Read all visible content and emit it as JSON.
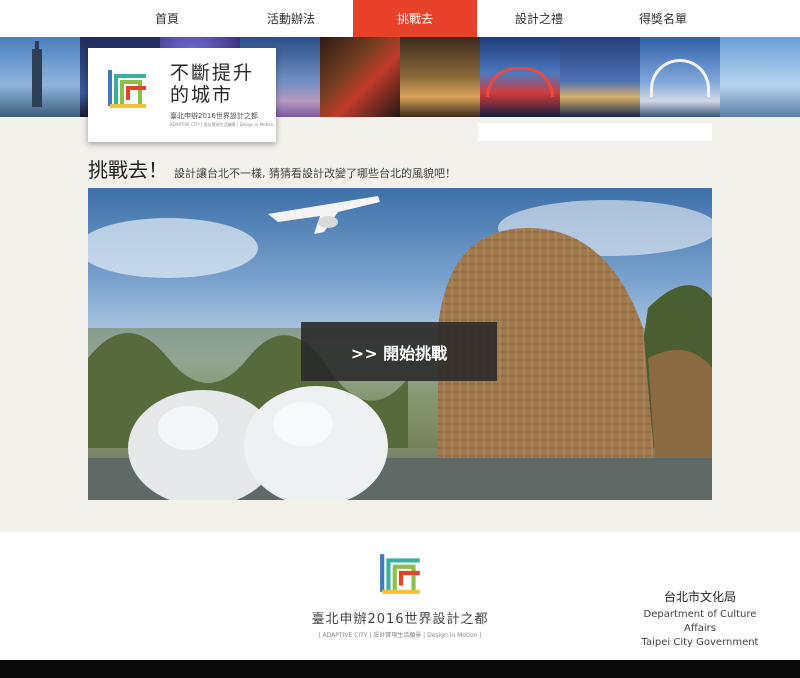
{
  "nav": {
    "items": [
      {
        "label": "首頁"
      },
      {
        "label": "活動辦法"
      },
      {
        "label": "挑戰去"
      },
      {
        "label": "設計之禮"
      },
      {
        "label": "得獎名單"
      }
    ],
    "active_index": 2
  },
  "logo": {
    "title": "不斷提升\n的城市",
    "subtitle": "臺北申辦2016世界設計之都",
    "tagline": "ADAPTIVE CITY | 設計實現生活願景 | Design in Motion"
  },
  "heading": {
    "title": "挑戰去！",
    "description": "設計讓台北不一樣, 猜猜看設計改變了哪些台北的風貌吧！"
  },
  "hero": {
    "cta_label": ">> 開始挑戰"
  },
  "footer": {
    "title": "臺北申辦2016世界設計之都",
    "subtitle": "| ADAPTIVE CITY | 設計實現生活願景 | Design in Motion |",
    "dept_calligraphy": "台北市文化局",
    "dept_line1": "Department of Culture Affairs",
    "dept_line2": "Taipei City Government"
  },
  "colors": {
    "accent": "#e8412a",
    "logo_stripes": [
      "#3c7bbf",
      "#3ab0a0",
      "#8ac04a",
      "#f0c23a",
      "#e8412a"
    ]
  }
}
